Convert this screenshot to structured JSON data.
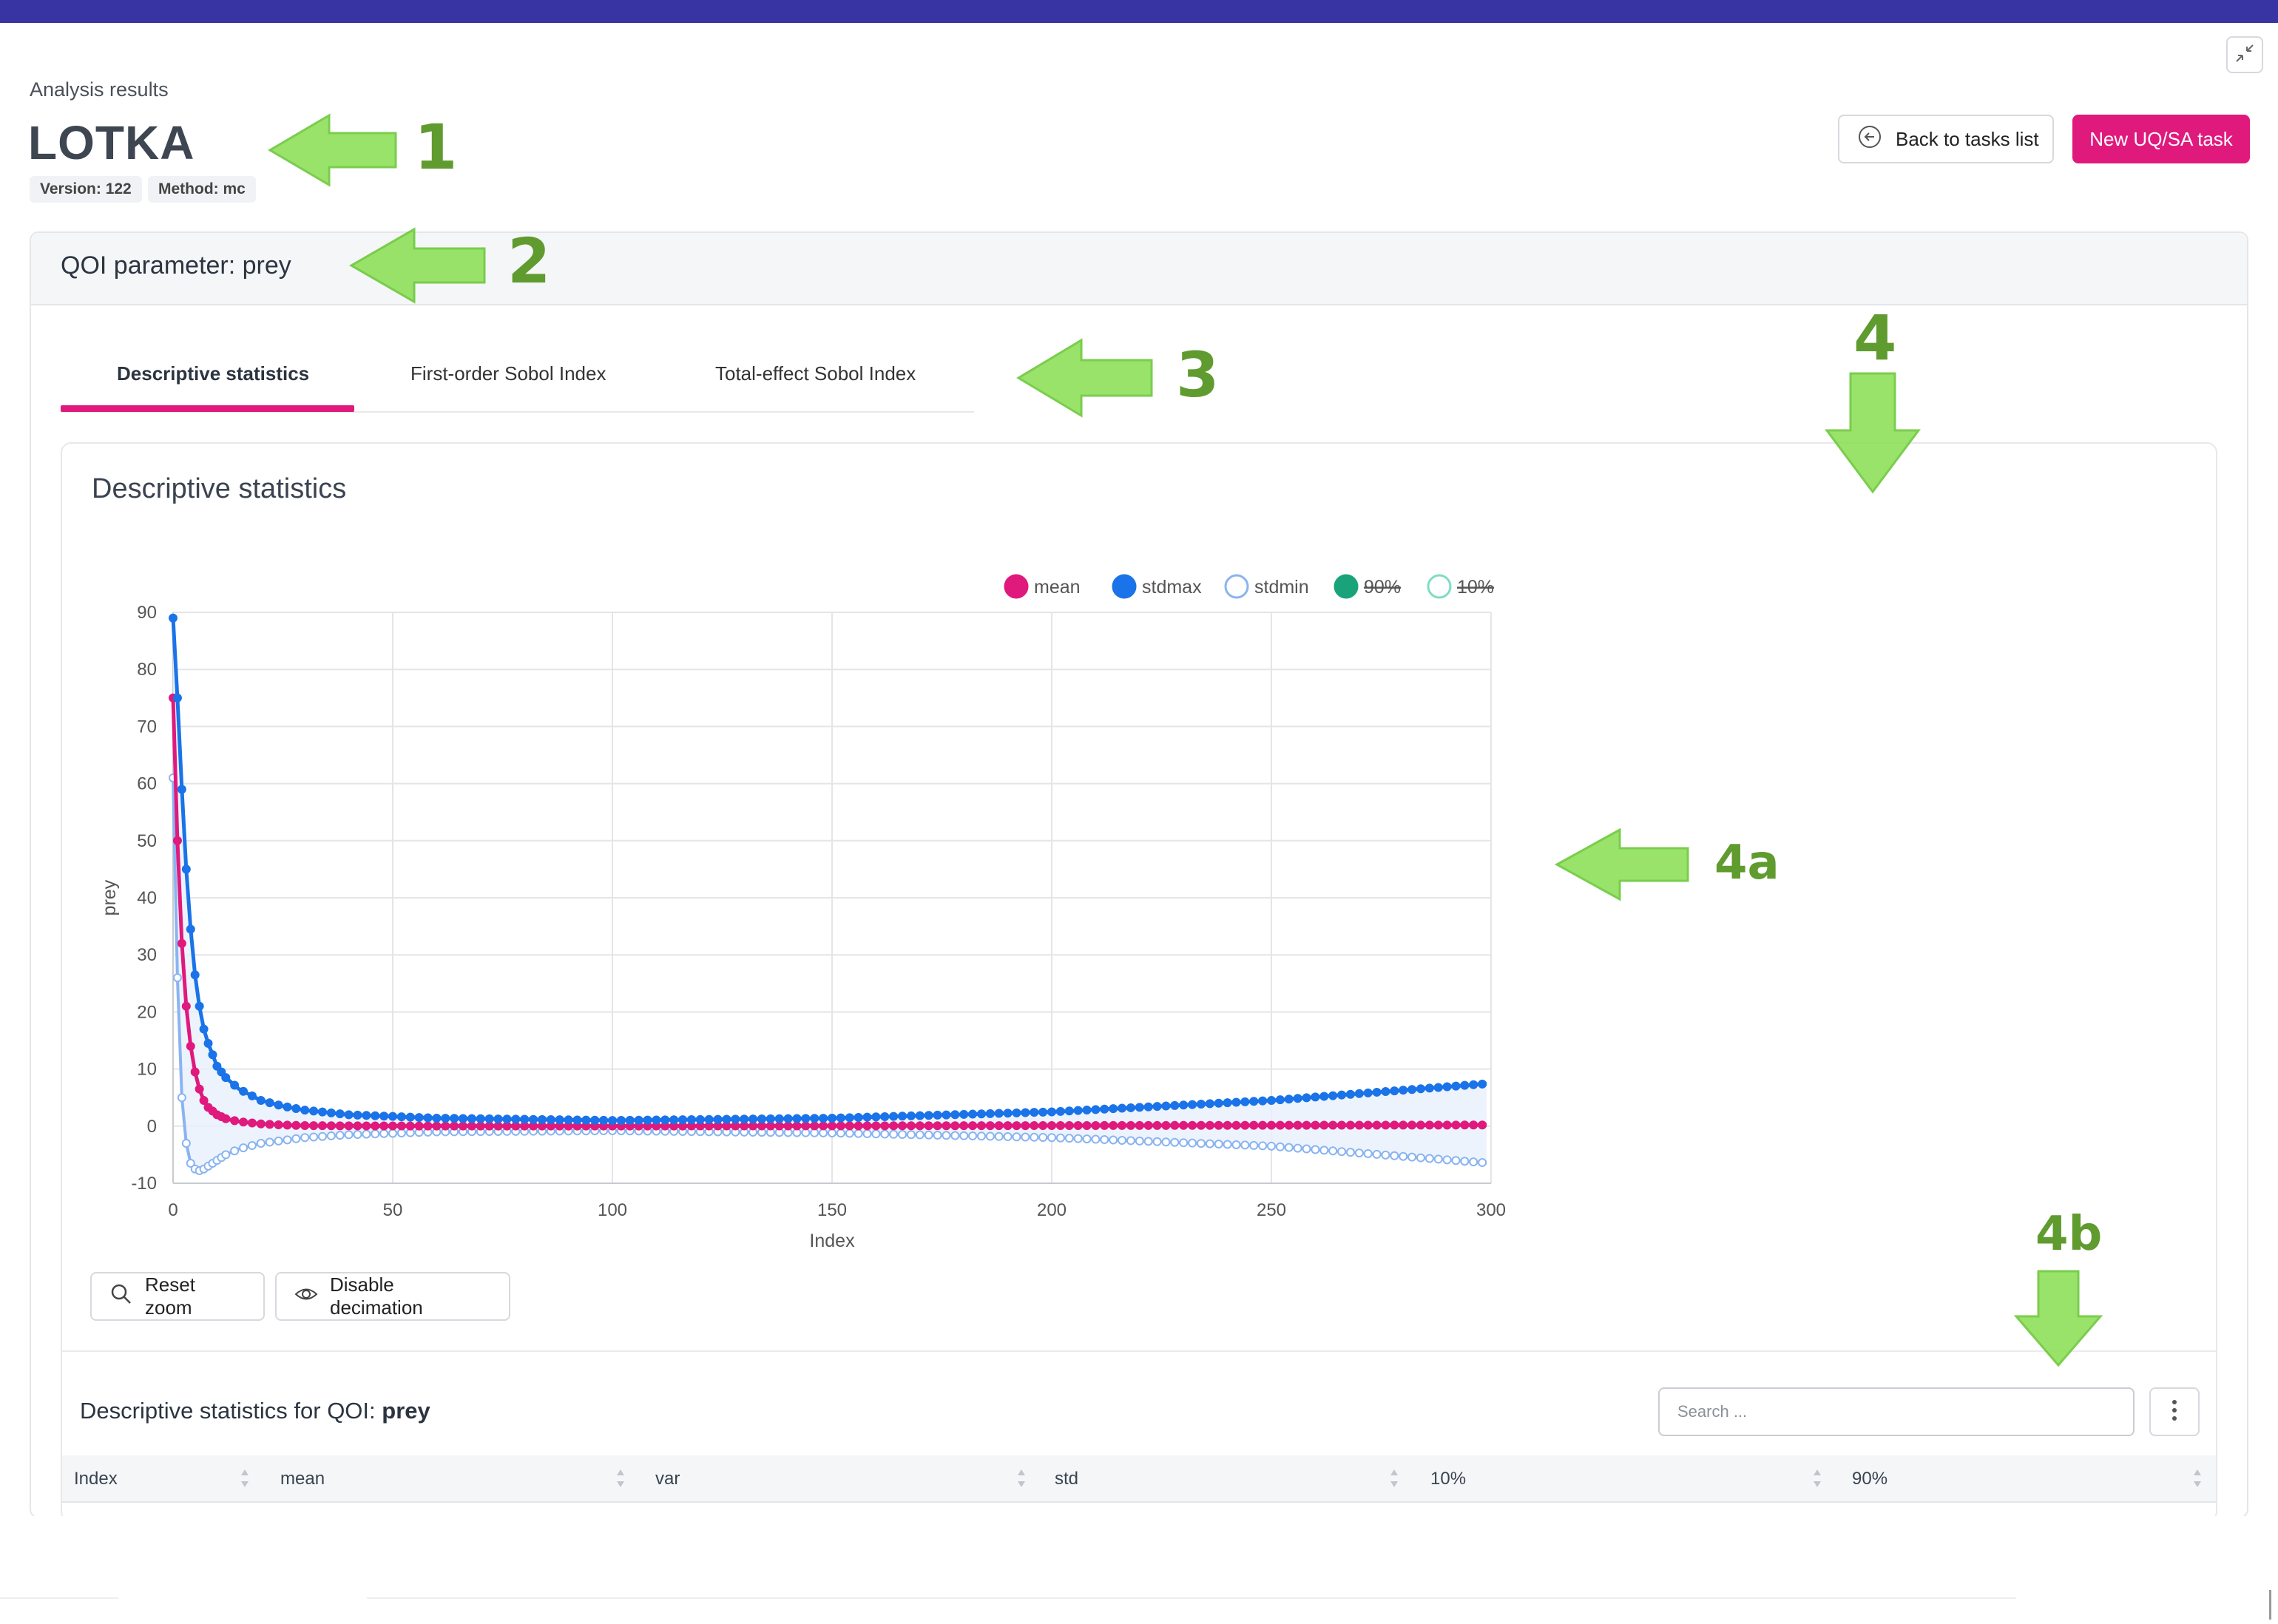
{
  "header": {
    "subtitle": "Analysis results",
    "title": "LOTKA",
    "version_badge": "Version: 122",
    "method_badge": "Method: mc",
    "back_button": "Back to tasks list",
    "new_task_button": "New UQ/SA task"
  },
  "qoi": {
    "label": "QOI parameter: prey"
  },
  "tabs": [
    {
      "label": "Descriptive statistics",
      "active": true
    },
    {
      "label": "First-order Sobol Index",
      "active": false
    },
    {
      "label": "Total-effect Sobol Index",
      "active": false
    }
  ],
  "panel": {
    "title": "Descriptive statistics",
    "reset_zoom": "Reset zoom",
    "disable_decimation": "Disable decimation"
  },
  "table": {
    "title_prefix": "Descriptive statistics for QOI: ",
    "title_qoi": "prey",
    "search_placeholder": "Search ...",
    "columns": [
      "Index",
      "mean",
      "var",
      "std",
      "10%",
      "90%"
    ]
  },
  "annotations": [
    "1",
    "2",
    "3",
    "4",
    "4a",
    "4b"
  ],
  "colors": {
    "topbar": "#3934a3",
    "accent": "#e0197d",
    "mean": "#e0197d",
    "stdmax": "#1a73e8",
    "stdmin": "#8ab4f0",
    "p90": "#1aa37a",
    "p10": "#7fdcc4",
    "annotation": "#7ed321"
  },
  "chart_data": {
    "type": "line",
    "xlabel": "Index",
    "ylabel": "prey",
    "xlim": [
      0,
      300
    ],
    "ylim": [
      -10,
      90
    ],
    "xticks": [
      0,
      50,
      100,
      150,
      200,
      250,
      300
    ],
    "yticks": [
      -10,
      0,
      10,
      20,
      30,
      40,
      50,
      60,
      70,
      80,
      90
    ],
    "grid": true,
    "legend_position": "top",
    "series": [
      {
        "name": "mean",
        "hidden": false,
        "x": [
          0,
          1,
          2,
          3,
          4,
          5,
          6,
          7,
          8,
          10,
          12,
          15,
          20,
          25,
          30,
          40,
          60,
          100,
          150,
          200,
          250,
          300
        ],
        "y": [
          75,
          50,
          32,
          21,
          14,
          9.5,
          6.5,
          4.5,
          3.3,
          2.0,
          1.3,
          0.8,
          0.4,
          0.2,
          0.1,
          0.05,
          0.02,
          0.02,
          0.05,
          0.1,
          0.15,
          0.2
        ]
      },
      {
        "name": "stdmax",
        "hidden": false,
        "x": [
          0,
          1,
          2,
          3,
          4,
          5,
          6,
          7,
          8,
          9,
          10,
          12,
          15,
          20,
          25,
          30,
          40,
          60,
          100,
          150,
          200,
          250,
          300
        ],
        "y": [
          89,
          75,
          59,
          45,
          34.5,
          26.5,
          21,
          17,
          14.5,
          12.5,
          10.5,
          8.5,
          6.5,
          4.5,
          3.5,
          2.8,
          2.0,
          1.4,
          1.0,
          1.4,
          2.5,
          4.5,
          7.5
        ]
      },
      {
        "name": "stdmin",
        "hidden": false,
        "x": [
          0,
          1,
          2,
          3,
          4,
          5,
          6,
          7,
          8,
          10,
          12,
          15,
          20,
          25,
          30,
          40,
          60,
          100,
          150,
          200,
          250,
          300
        ],
        "y": [
          61,
          26,
          5,
          -3,
          -6.5,
          -7.5,
          -7.8,
          -7.5,
          -7,
          -6,
          -5,
          -4,
          -3,
          -2.5,
          -2,
          -1.5,
          -1,
          -0.8,
          -1.2,
          -2,
          -3.5,
          -6.5
        ]
      },
      {
        "name": "90%",
        "hidden": true
      },
      {
        "name": "10%",
        "hidden": true
      }
    ]
  }
}
